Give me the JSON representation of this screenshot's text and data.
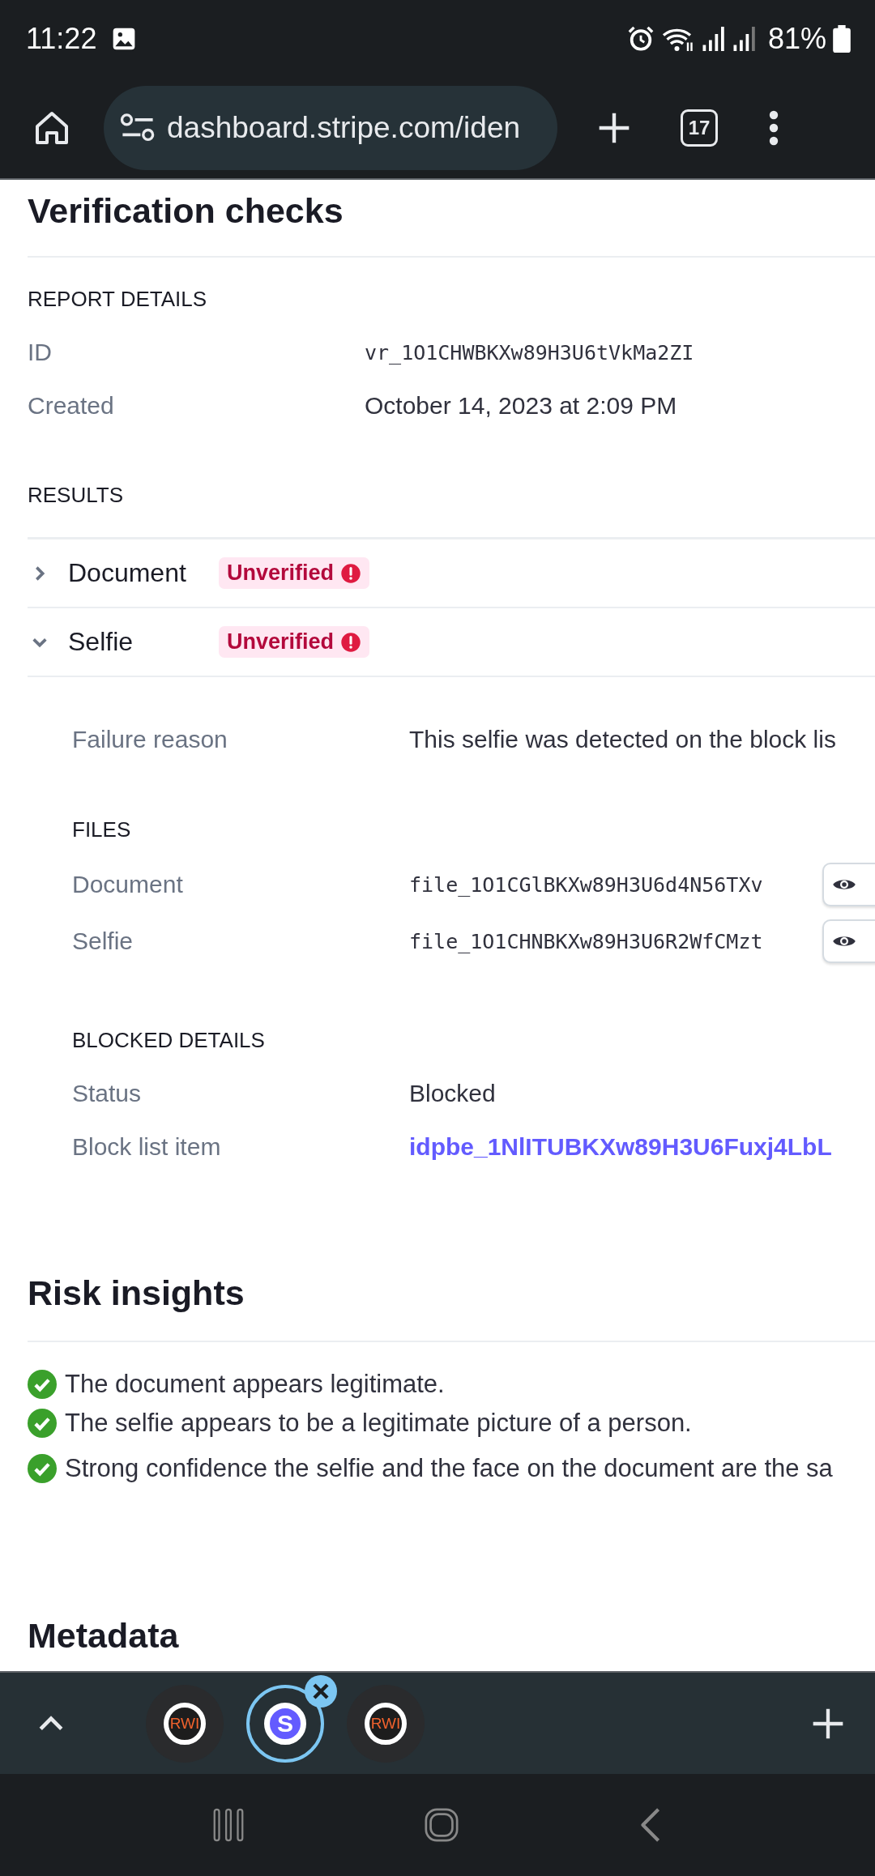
{
  "status_bar": {
    "time": "11:22",
    "battery": "81%"
  },
  "browser": {
    "url": "dashboard.stripe.com/iden",
    "tab_count": "17"
  },
  "page": {
    "title": "Verification checks",
    "report_details": {
      "heading": "REPORT DETAILS",
      "fields": [
        {
          "label": "ID",
          "value": "vr_1O1CHWBKXw89H3U6tVkMa2ZI",
          "kind": "mono"
        },
        {
          "label": "Created",
          "value": "October 14, 2023 at 2:09 PM",
          "kind": "text"
        }
      ]
    },
    "results": {
      "heading": "RESULTS",
      "items": [
        {
          "name": "Document",
          "badge": "Unverified",
          "expanded": false
        },
        {
          "name": "Selfie",
          "badge": "Unverified",
          "expanded": true
        }
      ]
    },
    "selfie_details": {
      "failure_reason": {
        "label": "Failure reason",
        "value": "This selfie was detected on the block lis"
      },
      "files": {
        "heading": "FILES",
        "items": [
          {
            "label": "Document",
            "value": "file_1O1CGlBKXw89H3U6d4N56TXv"
          },
          {
            "label": "Selfie",
            "value": "file_1O1CHNBKXw89H3U6R2WfCMzt"
          }
        ]
      },
      "blocked_details": {
        "heading": "BLOCKED DETAILS",
        "fields": [
          {
            "label": "Status",
            "value": "Blocked",
            "kind": "text"
          },
          {
            "label": "Block list item",
            "value": "idpbe_1NlITUBKXw89H3U6Fuxj4LbL",
            "kind": "link"
          }
        ]
      }
    },
    "risk_insights": {
      "title": "Risk insights",
      "items": [
        {
          "text": "The document appears legitimate.",
          "passed": true
        },
        {
          "text": "The selfie appears to be a legitimate picture of a person.",
          "passed": true
        },
        {
          "text": "Strong confidence the selfie and the face on the document are the sa",
          "passed": true
        }
      ]
    },
    "metadata": {
      "title": "Metadata"
    }
  },
  "tab_strip": {
    "tabs": [
      {
        "icon_text": "RWI",
        "kind": "rwi",
        "selected": false
      },
      {
        "icon_text": "S",
        "kind": "stripe",
        "selected": true
      },
      {
        "icon_text": "RWI",
        "kind": "rwi",
        "selected": false
      }
    ]
  }
}
